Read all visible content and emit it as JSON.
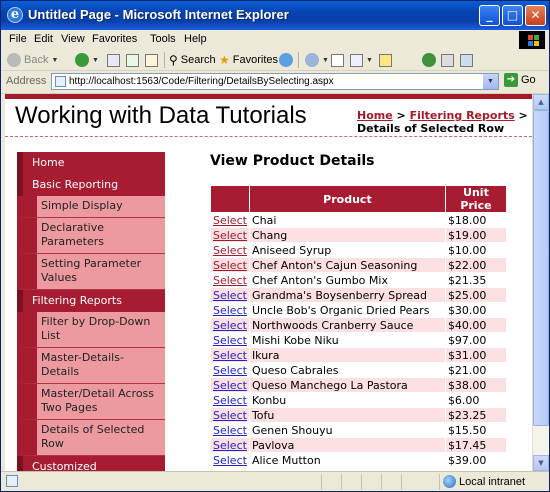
{
  "window": {
    "title": "Untitled Page - Microsoft Internet Explorer"
  },
  "menu": [
    "File",
    "Edit",
    "View",
    "Favorites",
    "Tools",
    "Help"
  ],
  "toolbar": {
    "back": "Back",
    "search": "Search",
    "favorites": "Favorites"
  },
  "address": {
    "label": "Address",
    "url": "http://localhost:1563/Code/Filtering/DetailsBySelecting.aspx",
    "go": "Go"
  },
  "page": {
    "site_title": "Working with Data Tutorials",
    "breadcrumb": {
      "home": "Home",
      "sep": " > ",
      "section": "Filtering Reports",
      "current": "Details of Selected Row"
    },
    "heading": "View Product Details"
  },
  "sidebar": {
    "items": [
      {
        "label": "Home",
        "level": "top"
      },
      {
        "label": "Basic Reporting",
        "level": "top"
      },
      {
        "label": "Simple Display",
        "level": "sub"
      },
      {
        "label": "Declarative Parameters",
        "level": "sub"
      },
      {
        "label": "Setting Parameter Values",
        "level": "sub"
      },
      {
        "label": "Filtering Reports",
        "level": "top"
      },
      {
        "label": "Filter by Drop-Down List",
        "level": "sub"
      },
      {
        "label": "Master-Details-Details",
        "level": "sub"
      },
      {
        "label": "Master/Detail Across Two Pages",
        "level": "sub"
      },
      {
        "label": "Details of Selected Row",
        "level": "sub"
      },
      {
        "label": "Customized",
        "level": "top"
      }
    ]
  },
  "grid": {
    "columns": [
      "",
      "Product",
      "Unit Price"
    ],
    "select_label": "Select",
    "rows": [
      {
        "product": "Chai",
        "price": "$18.00"
      },
      {
        "product": "Chang",
        "price": "$19.00"
      },
      {
        "product": "Aniseed Syrup",
        "price": "$10.00"
      },
      {
        "product": "Chef Anton's Cajun Seasoning",
        "price": "$22.00"
      },
      {
        "product": "Chef Anton's Gumbo Mix",
        "price": "$21.35"
      },
      {
        "product": "Grandma's Boysenberry Spread",
        "price": "$25.00"
      },
      {
        "product": "Uncle Bob's Organic Dried Pears",
        "price": "$30.00"
      },
      {
        "product": "Northwoods Cranberry Sauce",
        "price": "$40.00"
      },
      {
        "product": "Mishi Kobe Niku",
        "price": "$97.00"
      },
      {
        "product": "Ikura",
        "price": "$31.00"
      },
      {
        "product": "Queso Cabrales",
        "price": "$21.00"
      },
      {
        "product": "Queso Manchego La Pastora",
        "price": "$38.00"
      },
      {
        "product": "Konbu",
        "price": "$6.00"
      },
      {
        "product": "Tofu",
        "price": "$23.25"
      },
      {
        "product": "Genen Shouyu",
        "price": "$15.50"
      },
      {
        "product": "Pavlova",
        "price": "$17.45"
      },
      {
        "product": "Alice Mutton",
        "price": "$39.00"
      }
    ]
  },
  "status": {
    "zone": "Local intranet"
  }
}
